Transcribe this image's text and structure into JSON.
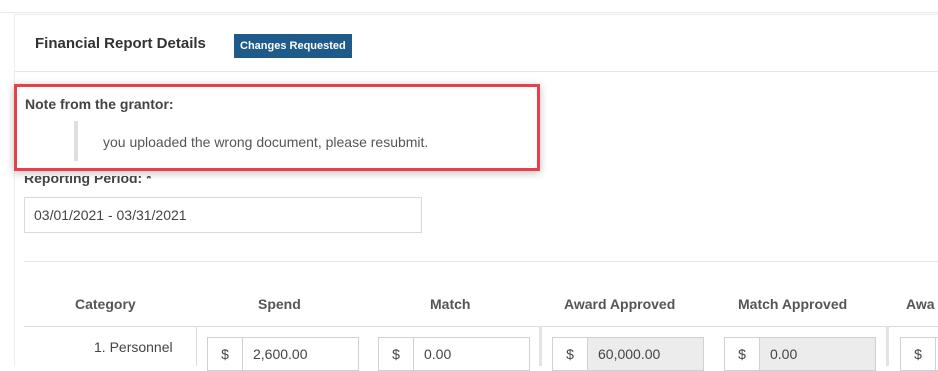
{
  "header": {
    "title": "Financial Report Details",
    "status_badge": "Changes Requested"
  },
  "note": {
    "title": "Note from the grantor:",
    "message": "you uploaded the wrong document, please resubmit."
  },
  "reporting_period": {
    "label": "Reporting Period: *",
    "value": "03/01/2021 - 03/31/2021"
  },
  "table": {
    "columns": [
      "Category",
      "Spend",
      "Match",
      "Award Approved",
      "Match Approved",
      "Awa"
    ],
    "rows": [
      {
        "category": "1. Personnel",
        "currency": "$",
        "spend": "2,600.00",
        "match": "0.00",
        "award_approved": "60,000.00",
        "match_approved": "0.00",
        "award_partial": ""
      }
    ]
  },
  "colors": {
    "badge": "#1e5a8a",
    "highlight_border": "#e8404a"
  }
}
